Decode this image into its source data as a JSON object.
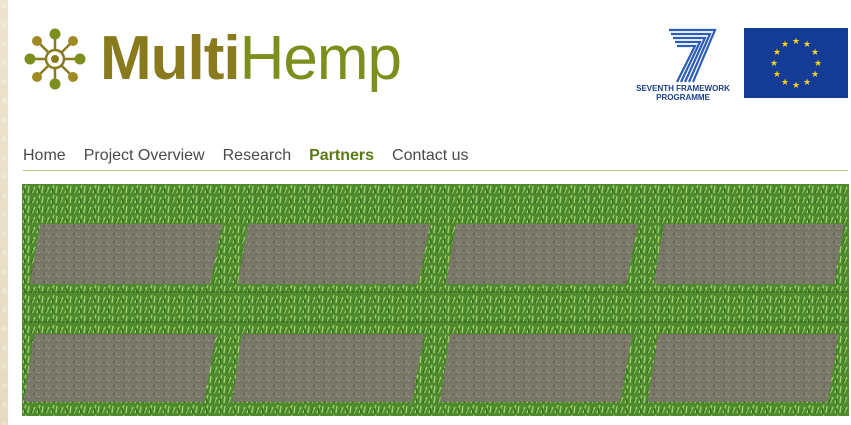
{
  "brand": {
    "name_bold": "Multi",
    "name_light": "Hemp",
    "logo_icon": "hemp-leaf-network-icon",
    "colors": {
      "bold": "#8a7a1e",
      "light": "#7c8f1c"
    }
  },
  "partners_logos": {
    "fp7_line1": "SEVENTH FRAMEWORK",
    "fp7_line2": "PROGRAMME",
    "eu_flag_icon": "eu-flag-icon"
  },
  "nav": {
    "items": [
      {
        "label": "Home"
      },
      {
        "label": "Project Overview"
      },
      {
        "label": "Research"
      },
      {
        "label": "Partners",
        "active": true
      },
      {
        "label": "Contact us"
      }
    ],
    "active_color": "#5a7a16"
  },
  "banner": {
    "image": "field-trial-plots-photo"
  }
}
